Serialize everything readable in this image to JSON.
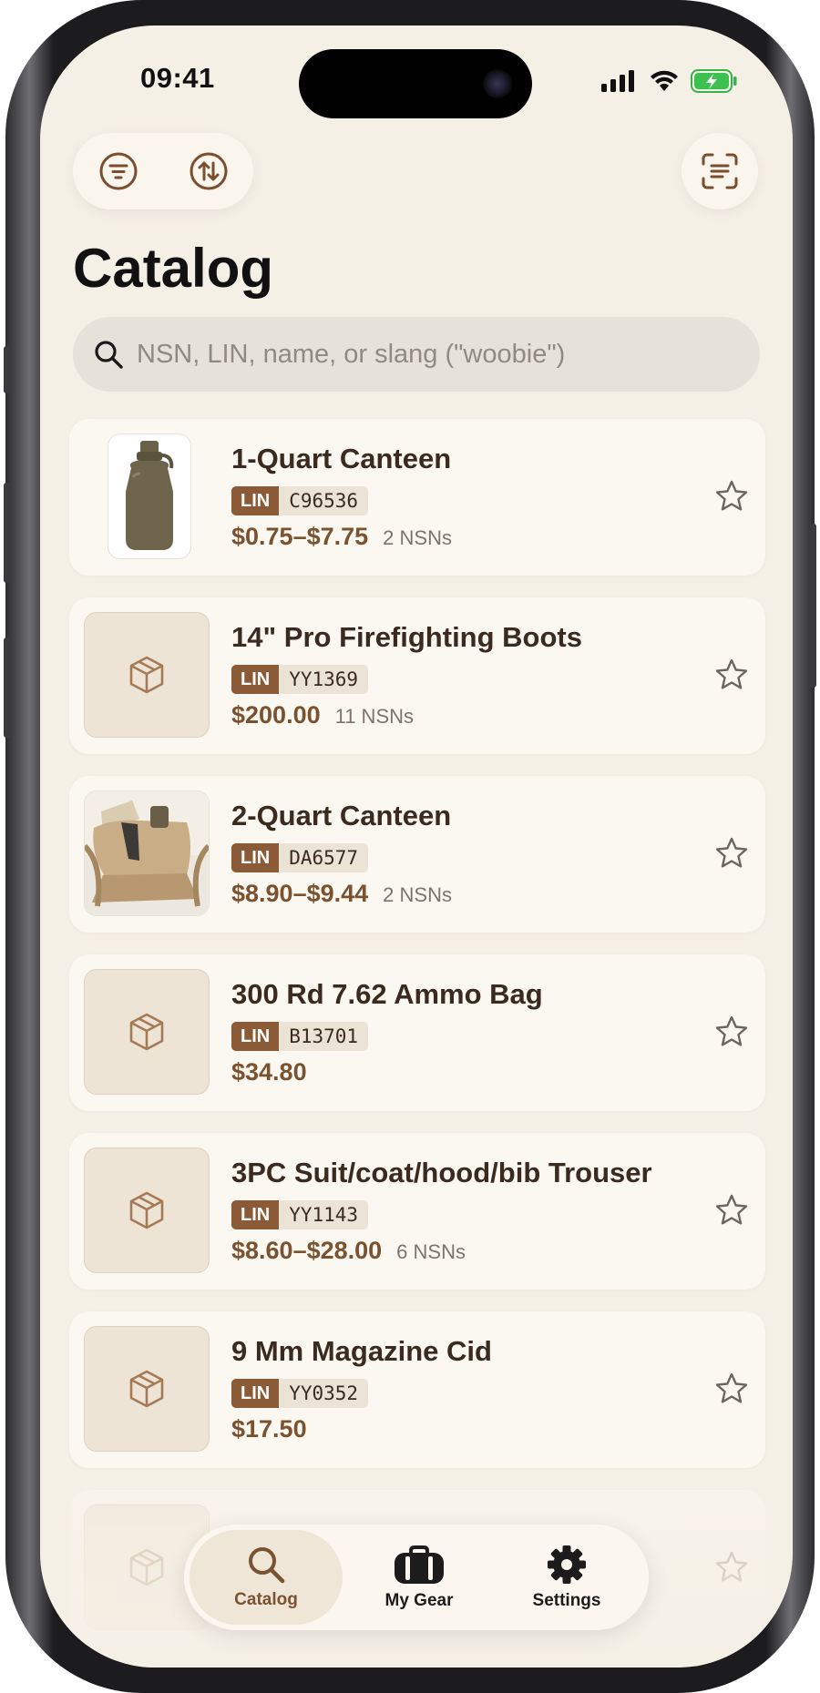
{
  "status_bar": {
    "time": "09:41"
  },
  "toolbar": {
    "filter_icon": "filter-icon",
    "sort_icon": "sort-icon",
    "scan_icon": "scan-icon"
  },
  "page": {
    "title": "Catalog"
  },
  "search": {
    "placeholder": "NSN, LIN, name, or slang (\"woobie\")"
  },
  "items": [
    {
      "name": "1-Quart Canteen",
      "lin_label": "LIN",
      "lin": "C96536",
      "price": "$0.75–$7.75",
      "nsns": "2 NSNs",
      "image": "canteen-photo"
    },
    {
      "name": "14\" Pro Firefighting Boots",
      "lin_label": "LIN",
      "lin": "YY1369",
      "price": "$200.00",
      "nsns": "11 NSNs",
      "image": "box-icon"
    },
    {
      "name": "2-Quart Canteen",
      "lin_label": "LIN",
      "lin": "DA6577",
      "price": "$8.90–$9.44",
      "nsns": "2 NSNs",
      "image": "canteen-cover-photo"
    },
    {
      "name": "300 Rd 7.62 Ammo Bag",
      "lin_label": "LIN",
      "lin": "B13701",
      "price": "$34.80",
      "nsns": "",
      "image": "box-icon"
    },
    {
      "name": "3PC Suit/coat/hood/bib Trouser",
      "lin_label": "LIN",
      "lin": "YY1143",
      "price": "$8.60–$28.00",
      "nsns": "6 NSNs",
      "image": "box-icon"
    },
    {
      "name": "9 Mm Magazine Cid",
      "lin_label": "LIN",
      "lin": "YY0352",
      "price": "$17.50",
      "nsns": "",
      "image": "box-icon"
    }
  ],
  "tabbar": {
    "tabs": [
      {
        "label": "Catalog",
        "icon": "search-icon",
        "active": true
      },
      {
        "label": "My Gear",
        "icon": "backpack-icon",
        "active": false
      },
      {
        "label": "Settings",
        "icon": "gear-icon",
        "active": false
      }
    ]
  },
  "colors": {
    "background": "#f5f0e6",
    "accent": "#8b5a36",
    "price": "#7a5230",
    "card": "#fbf8f1"
  }
}
